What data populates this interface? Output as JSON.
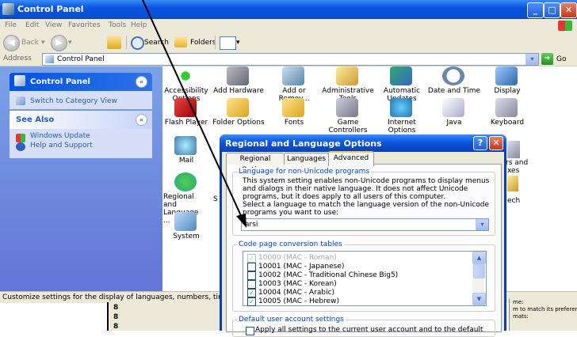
{
  "control_panel": {
    "title": "Control Panel",
    "menu": [
      "File",
      "Edit",
      "View",
      "Favorites",
      "Tools",
      "Help"
    ],
    "toolbar": {
      "back": "Back",
      "search": "Search",
      "folders": "Folders"
    },
    "address": {
      "label": "Address",
      "value": "Control Panel",
      "go": "Go"
    },
    "sidebar": {
      "panel_title": "Control Panel",
      "switch_view": "Switch to Category View",
      "see_also_title": "See Also",
      "links": [
        "Windows Update",
        "Help and Support"
      ]
    },
    "icons": [
      "Accessibility Options",
      "Add Hardware",
      "Add or Remov...",
      "Administrative Tools",
      "Automatic Updates",
      "Date and Time",
      "Display",
      "Flash Player",
      "Folder Options",
      "Fonts",
      "Game Controllers",
      "Internet Options",
      "Java",
      "Keyboard",
      "Mail",
      "Regional and Language ...",
      "System"
    ],
    "partial_labels": [
      "rs and",
      "xes",
      "ech",
      "S"
    ],
    "status": "Customize settings for the display of languages, numbers, tim"
  },
  "background_fragments": {
    "right_lines": [
      "me:",
      "m to match its preferen",
      "mats:"
    ],
    "left_glyphs": [
      "8",
      "8",
      "8"
    ]
  },
  "dialog": {
    "title": "Regional and Language Options",
    "tabs": [
      "Regional Options",
      "Languages",
      "Advanced"
    ],
    "nonunicode_group": "Language for non-Unicode programs",
    "nonunicode_desc": "This system setting enables non-Unicode programs to display menus and dialogs in their native language. It does not affect Unicode programs, but it does apply to all users of this computer.",
    "select_prompt": "Select a language to match the language version of the non-Unicode programs you want to use:",
    "selected_language": "arsi",
    "codepage_group": "Code page conversion tables",
    "codepages": [
      {
        "label": "10000 (MAC - Roman)",
        "checked": true,
        "disabled": true
      },
      {
        "label": "10001 (MAC - Japanese)",
        "checked": false,
        "disabled": false
      },
      {
        "label": "10002 (MAC - Traditional Chinese Big5)",
        "checked": false,
        "disabled": false
      },
      {
        "label": "10003 (MAC - Korean)",
        "checked": false,
        "disabled": false
      },
      {
        "label": "10004 (MAC - Arabic)",
        "checked": true,
        "disabled": false
      },
      {
        "label": "10005 (MAC - Hebrew)",
        "checked": true,
        "disabled": false
      }
    ],
    "user_settings_group": "Default user account settings",
    "apply_all": "Apply all settings to the current user account and to the default"
  }
}
